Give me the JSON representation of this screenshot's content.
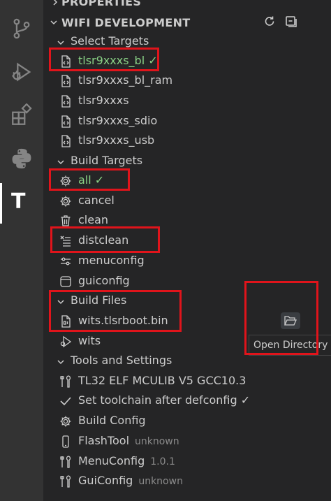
{
  "activity_bar": {
    "icons": [
      "source-control-icon",
      "run-debug-icon",
      "extensions-icon",
      "python-icon",
      "tlsr-icon"
    ],
    "active_letter": "T"
  },
  "panel": {
    "prev_section": "PROPERTIES",
    "title": "WIFI DEVELOPMENT"
  },
  "select_targets": {
    "label": "Select Targets",
    "items": [
      "tlsr9xxxs_bl ✓",
      "tlsr9xxxs_bl_ram",
      "tlsr9xxxs",
      "tlsr9xxxs_sdio",
      "tlsr9xxxs_usb"
    ]
  },
  "build_targets": {
    "label": "Build Targets",
    "items": [
      "all ✓",
      "cancel",
      "clean",
      "distclean",
      "menuconfig",
      "guiconfig"
    ]
  },
  "build_files": {
    "label": "Build Files",
    "items": [
      "wits.tlsrboot.bin",
      "wits"
    ],
    "tooltip": "Open Directory"
  },
  "tools": {
    "label": "Tools and Settings",
    "items": [
      {
        "label": "TL32 ELF MCULIB V5 GCC10.3",
        "detail": ""
      },
      {
        "label": "Set toolchain after defconfig ✓",
        "detail": ""
      },
      {
        "label": "Build Config",
        "detail": ""
      },
      {
        "label": "FlashTool",
        "detail": "unknown"
      },
      {
        "label": "MenuConfig",
        "detail": "1.0.1"
      },
      {
        "label": "GuiConfig",
        "detail": "unknown"
      }
    ]
  },
  "colors": {
    "accent_green": "#89d185",
    "highlight_red": "#e0141b"
  }
}
